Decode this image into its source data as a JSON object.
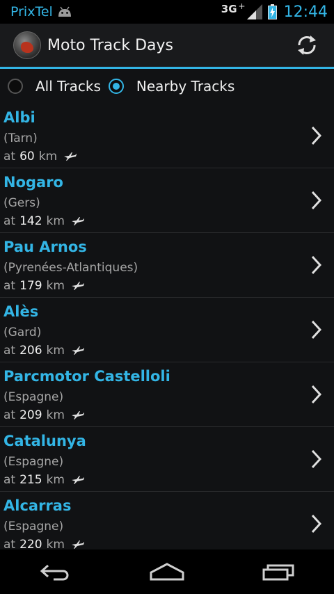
{
  "status_bar": {
    "carrier": "PrixTel",
    "network": "3G",
    "network_plus": "+",
    "time": "12:44"
  },
  "action_bar": {
    "title": "Moto Track Days",
    "refresh_icon": "refresh-icon"
  },
  "filter": {
    "options": [
      {
        "label": "All Tracks",
        "selected": false
      },
      {
        "label": "Nearby Tracks",
        "selected": true
      }
    ]
  },
  "tracks": [
    {
      "name": "Albi",
      "region": "(Tarn)",
      "prefix": "at",
      "distance": "60",
      "unit": "km"
    },
    {
      "name": "Nogaro",
      "region": "(Gers)",
      "prefix": "at",
      "distance": "142",
      "unit": "km"
    },
    {
      "name": "Pau Arnos",
      "region": "(Pyrenées-Atlantiques)",
      "prefix": "at",
      "distance": "179",
      "unit": "km"
    },
    {
      "name": "Alès",
      "region": "(Gard)",
      "prefix": "at",
      "distance": "206",
      "unit": "km"
    },
    {
      "name": "Parcmotor Castelloli",
      "region": "(Espagne)",
      "prefix": "at",
      "distance": "209",
      "unit": "km"
    },
    {
      "name": "Catalunya",
      "region": "(Espagne)",
      "prefix": "at",
      "distance": "215",
      "unit": "km"
    },
    {
      "name": "Alcarras",
      "region": "(Espagne)",
      "prefix": "at",
      "distance": "220",
      "unit": "km"
    }
  ],
  "colors": {
    "accent": "#33b5e5",
    "background": "#111214",
    "secondary_text": "#a6a6a6"
  }
}
